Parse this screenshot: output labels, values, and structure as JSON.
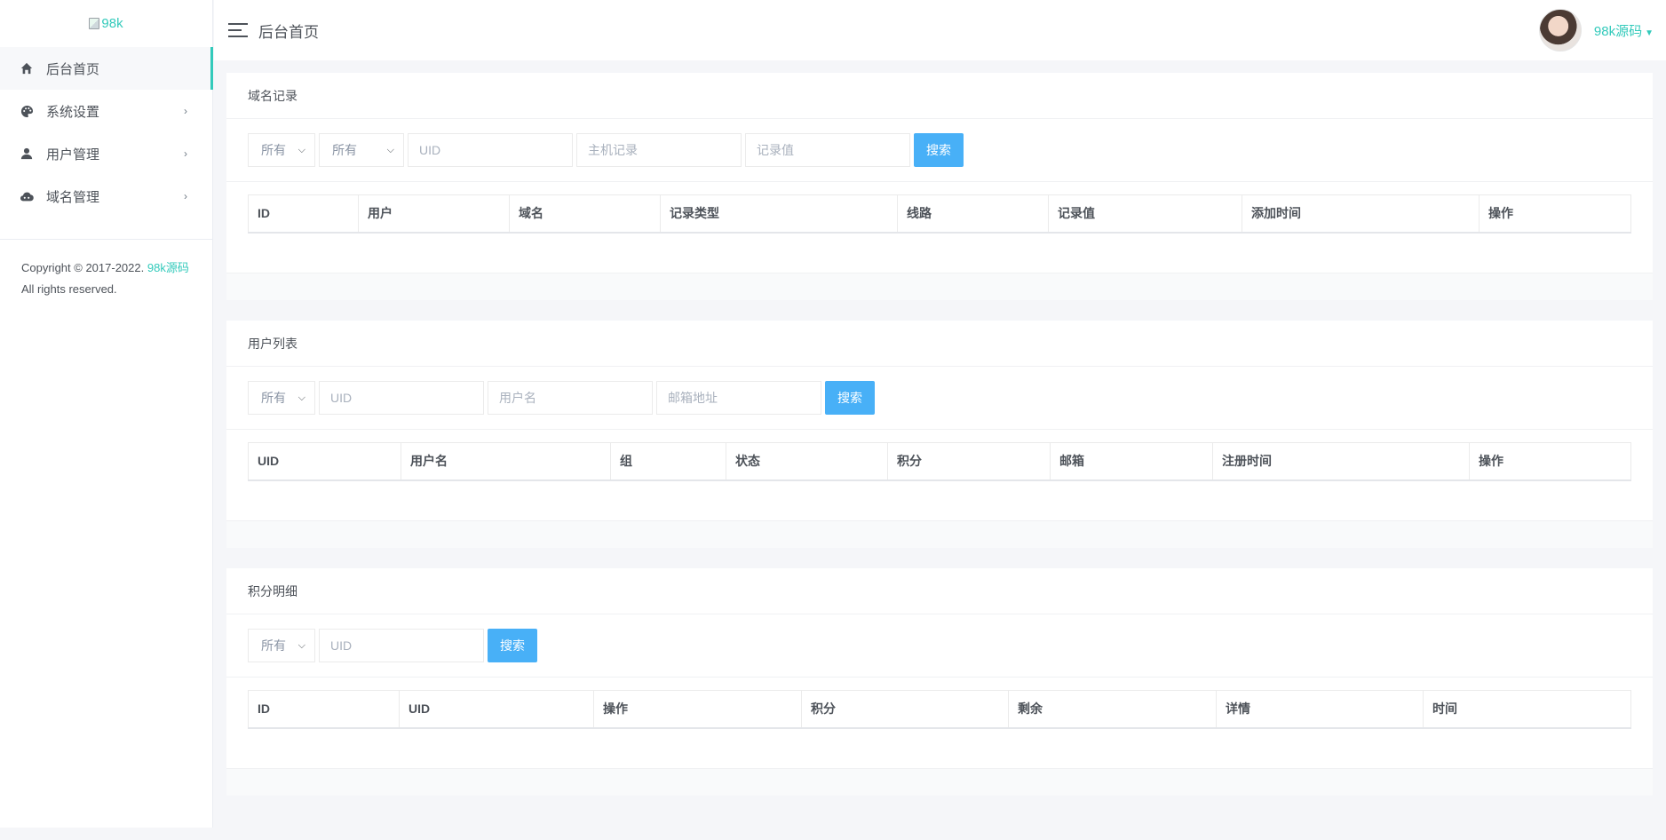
{
  "sidebar": {
    "logo_alt": "98k",
    "items": [
      {
        "label": "后台首页",
        "icon": "home-icon",
        "has_children": false,
        "active": true
      },
      {
        "label": "系统设置",
        "icon": "palette-icon",
        "has_children": true,
        "active": false
      },
      {
        "label": "用户管理",
        "icon": "user-icon",
        "has_children": true,
        "active": false
      },
      {
        "label": "域名管理",
        "icon": "cloud-icon",
        "has_children": true,
        "active": false
      }
    ],
    "copyright_prefix": "Copyright © 2017-2022.",
    "copyright_brand": "98k源码",
    "copyright_suffix": "All rights reserved."
  },
  "header": {
    "title": "后台首页",
    "username": "98k源码"
  },
  "cards": {
    "domains": {
      "title": "域名记录",
      "filter1": "所有",
      "filter2": "所有",
      "uid_placeholder": "UID",
      "host_placeholder": "主机记录",
      "value_placeholder": "记录值",
      "search_label": "搜索",
      "columns": [
        "ID",
        "用户",
        "域名",
        "记录类型",
        "线路",
        "记录值",
        "添加时间",
        "操作"
      ]
    },
    "users": {
      "title": "用户列表",
      "filter1": "所有",
      "uid_placeholder": "UID",
      "username_placeholder": "用户名",
      "email_placeholder": "邮箱地址",
      "search_label": "搜索",
      "columns": [
        "UID",
        "用户名",
        "组",
        "状态",
        "积分",
        "邮箱",
        "注册时间",
        "操作"
      ]
    },
    "points": {
      "title": "积分明细",
      "filter1": "所有",
      "uid_placeholder": "UID",
      "search_label": "搜索",
      "columns": [
        "ID",
        "UID",
        "操作",
        "积分",
        "剩余",
        "详情",
        "时间"
      ]
    }
  },
  "colors": {
    "accent": "#33cabb",
    "button": "#48b0f7"
  }
}
